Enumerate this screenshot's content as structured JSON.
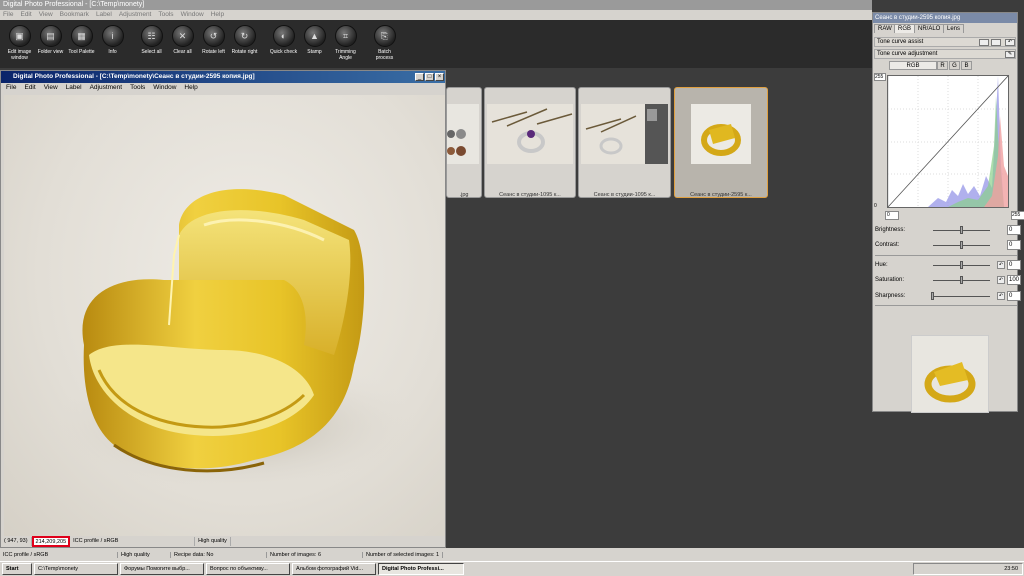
{
  "app_title": "Digital Photo Professional - [C:\\Temp\\monety]",
  "menu": [
    "File",
    "Edit",
    "View",
    "Bookmark",
    "Label",
    "Adjustment",
    "Tools",
    "Window",
    "Help"
  ],
  "toolbar": [
    {
      "label": "Edit image window",
      "icon": "edit-window-icon"
    },
    {
      "label": "Folder view",
      "icon": "folder-view-icon"
    },
    {
      "label": "Tool Palette",
      "icon": "tool-palette-icon"
    },
    {
      "label": "Info",
      "icon": "info-icon"
    },
    {
      "label": "Select all",
      "icon": "select-all-icon"
    },
    {
      "label": "Clear all",
      "icon": "clear-all-icon"
    },
    {
      "label": "Rotate left",
      "icon": "rotate-left-icon"
    },
    {
      "label": "Rotate right",
      "icon": "rotate-right-icon"
    },
    {
      "label": "Quick check",
      "icon": "quick-check-icon"
    },
    {
      "label": "Stamp",
      "icon": "stamp-icon"
    },
    {
      "label": "Trimming Angle",
      "icon": "trimming-icon"
    },
    {
      "label": "Batch process",
      "icon": "batch-process-icon"
    }
  ],
  "image_window": {
    "title": "Digital Photo Professional - [C:\\Temp\\monety\\Сеанс в студии-2595 копия.jpg]",
    "menu": [
      "File",
      "Edit",
      "View",
      "Label",
      "Adjustment",
      "Tools",
      "Window",
      "Help"
    ],
    "status": {
      "coords": "( 947,  93)",
      "pixel": "214,209,205",
      "profile": "ICC profile / sRGB",
      "quality": "High quality"
    }
  },
  "thumbnails": [
    {
      "caption": ".jpg",
      "selected": false
    },
    {
      "caption": "Сеанс в студии-1095 к...",
      "selected": false
    },
    {
      "caption": "Сеанс в студии-1095 к...",
      "selected": false
    },
    {
      "caption": "Сеанс в студии-2595 к...",
      "selected": true
    }
  ],
  "palette": {
    "title": "Сеанс в студии-2595 копия.jpg",
    "tabs": [
      "RAW",
      "RGB",
      "NR/ALO",
      "Lens"
    ],
    "tone_curve_assist": "Tone curve assist",
    "tone_curve_adjustment": "Tone curve adjustment",
    "channel_tabs": [
      "RGB",
      "R",
      "G",
      "B"
    ],
    "hist_top": "255",
    "hist_bottom": "0",
    "in_min": "0",
    "in_max": "255",
    "sliders": [
      {
        "label": "Brightness:",
        "value": "0",
        "pos": 0.5,
        "reset": false
      },
      {
        "label": "Contrast:",
        "value": "0",
        "pos": 0.5,
        "reset": false
      },
      {
        "label": "Hue:",
        "value": "0",
        "pos": 0.5,
        "reset": true
      },
      {
        "label": "Saturation:",
        "value": "100",
        "pos": 0.5,
        "reset": true
      },
      {
        "label": "Sharpness:",
        "value": "0",
        "pos": 0.0,
        "reset": true
      }
    ]
  },
  "app_status": [
    "ICC profile / sRGB",
    "High quality",
    "Recipe data: No",
    "Number of images: 6",
    "Number of selected images: 1"
  ],
  "taskbar": {
    "start": "Start",
    "tasks": [
      {
        "label": "C:\\Temp\\monety",
        "active": false
      },
      {
        "label": "Форумы Помогите выбр...",
        "active": false
      },
      {
        "label": "Вопрос по объективу...",
        "active": false
      },
      {
        "label": "Альбом фотографий Vid...",
        "active": false
      },
      {
        "label": "Digital Photo Professi...",
        "active": true
      }
    ],
    "clock": "23:50"
  },
  "colors": {
    "accent": "#0a246a",
    "highlight": "#e0001a",
    "selected_border": "#e0a040"
  }
}
